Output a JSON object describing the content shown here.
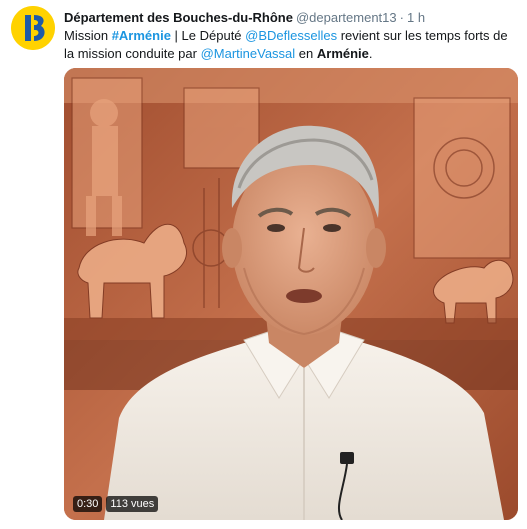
{
  "tweet": {
    "author_name": "Département des Bouches-du-Rhône",
    "handle": "@departement13",
    "separator": "·",
    "time": "1 h",
    "text": {
      "t1": "Mission ",
      "hashtag": "#Arménie",
      "t2": " | Le Député ",
      "mention1": "@BDeflesselles",
      "t3": " revient sur les temps forts de la mission conduite par ",
      "mention2": "@MartineVassal",
      "t4": " en ",
      "bold_word": "Arménie",
      "t5": "."
    },
    "avatar_letter": "13"
  },
  "video": {
    "duration": "0:30",
    "views": "113 vues"
  },
  "colors": {
    "link": "#1b95e0",
    "secondary_text": "#657786",
    "avatar_bg": "#ffd200",
    "avatar_accent": "#1e5aa8"
  },
  "icons": {
    "avatar": "departement-13-logo-icon"
  }
}
